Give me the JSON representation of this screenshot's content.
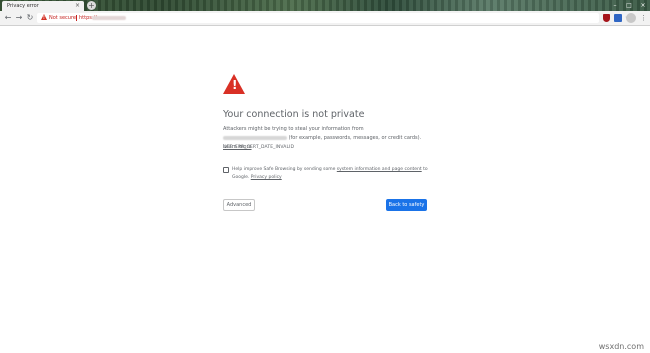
{
  "window": {
    "tab_title": "Privacy error",
    "tab_close": "×",
    "new_tab": "+",
    "minimize": "–",
    "maximize": "□",
    "close": "×"
  },
  "toolbar": {
    "back_icon": "←",
    "forward_icon": "→",
    "reload_icon": "↻",
    "security_status": "Not secure",
    "url_prefix": "https://",
    "star_icon": "☆",
    "menu_icon": "⋮"
  },
  "icons": {
    "warning": "warning-triangle-icon",
    "shield_extension": "shield-icon",
    "cast_extension": "cast-icon",
    "profile": "avatar-icon"
  },
  "interstitial": {
    "heading": "Your connection is not private",
    "description_before": "Attackers might be trying to steal your information from ",
    "description_after": " (for example, passwords, messages, or credit cards). ",
    "learn_more": "Learn more",
    "error_code": "NET::ERR_CERT_DATE_INVALID",
    "checkbox_text_before": "Help improve Safe Browsing by sending some ",
    "checkbox_link": "system information and page content",
    "checkbox_text_mid": " to Google. ",
    "privacy_policy": "Privacy policy",
    "advanced_button": "Advanced",
    "back_button": "Back to safety"
  },
  "colors": {
    "warning_red": "#d93025",
    "primary_blue": "#1a73e8",
    "text_gray": "#5f6368"
  },
  "watermark": "wsxdn.com"
}
